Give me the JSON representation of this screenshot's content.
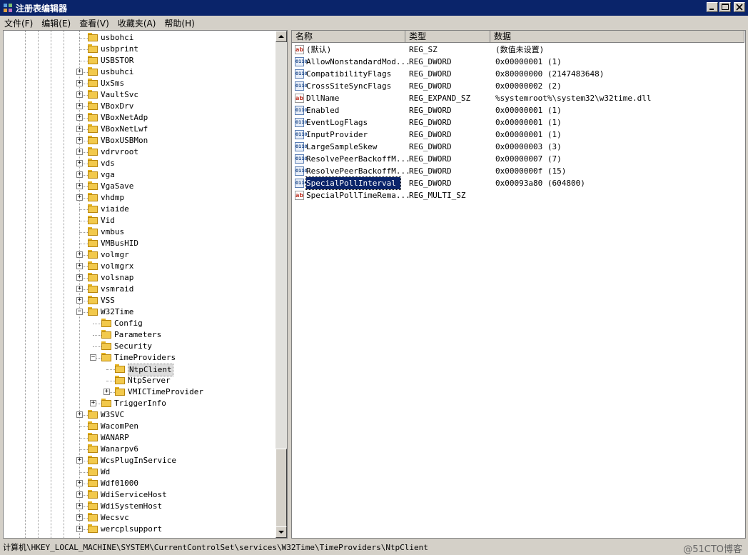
{
  "window": {
    "title": "注册表编辑器",
    "minimize_glyph": "_",
    "maximize_glyph": "□",
    "close_glyph": "×"
  },
  "menu": [
    "文件(F)",
    "编辑(E)",
    "查看(V)",
    "收藏夹(A)",
    "帮助(H)"
  ],
  "tree": {
    "items": [
      {
        "label": "usbohci",
        "level": 0,
        "expander": ""
      },
      {
        "label": "usbprint",
        "level": 0,
        "expander": ""
      },
      {
        "label": "USBSTOR",
        "level": 0,
        "expander": ""
      },
      {
        "label": "usbuhci",
        "level": 0,
        "expander": "+"
      },
      {
        "label": "UxSms",
        "level": 0,
        "expander": "+"
      },
      {
        "label": "VaultSvc",
        "level": 0,
        "expander": "+"
      },
      {
        "label": "VBoxDrv",
        "level": 0,
        "expander": "+"
      },
      {
        "label": "VBoxNetAdp",
        "level": 0,
        "expander": "+"
      },
      {
        "label": "VBoxNetLwf",
        "level": 0,
        "expander": "+"
      },
      {
        "label": "VBoxUSBMon",
        "level": 0,
        "expander": "+"
      },
      {
        "label": "vdrvroot",
        "level": 0,
        "expander": "+"
      },
      {
        "label": "vds",
        "level": 0,
        "expander": "+"
      },
      {
        "label": "vga",
        "level": 0,
        "expander": "+"
      },
      {
        "label": "VgaSave",
        "level": 0,
        "expander": "+"
      },
      {
        "label": "vhdmp",
        "level": 0,
        "expander": "+"
      },
      {
        "label": "viaide",
        "level": 0,
        "expander": ""
      },
      {
        "label": "Vid",
        "level": 0,
        "expander": ""
      },
      {
        "label": "vmbus",
        "level": 0,
        "expander": ""
      },
      {
        "label": "VMBusHID",
        "level": 0,
        "expander": ""
      },
      {
        "label": "volmgr",
        "level": 0,
        "expander": "+"
      },
      {
        "label": "volmgrx",
        "level": 0,
        "expander": "+"
      },
      {
        "label": "volsnap",
        "level": 0,
        "expander": "+"
      },
      {
        "label": "vsmraid",
        "level": 0,
        "expander": "+"
      },
      {
        "label": "VSS",
        "level": 0,
        "expander": "+"
      },
      {
        "label": "W32Time",
        "level": 0,
        "expander": "−"
      },
      {
        "label": "Config",
        "level": 1,
        "expander": ""
      },
      {
        "label": "Parameters",
        "level": 1,
        "expander": ""
      },
      {
        "label": "Security",
        "level": 1,
        "expander": ""
      },
      {
        "label": "TimeProviders",
        "level": 1,
        "expander": "−"
      },
      {
        "label": "NtpClient",
        "level": 2,
        "expander": "",
        "selected": true
      },
      {
        "label": "NtpServer",
        "level": 2,
        "expander": ""
      },
      {
        "label": "VMICTimeProvider",
        "level": 2,
        "expander": "+"
      },
      {
        "label": "TriggerInfo",
        "level": 1,
        "expander": "+"
      },
      {
        "label": "W3SVC",
        "level": 0,
        "expander": "+"
      },
      {
        "label": "WacomPen",
        "level": 0,
        "expander": ""
      },
      {
        "label": "WANARP",
        "level": 0,
        "expander": ""
      },
      {
        "label": "Wanarpv6",
        "level": 0,
        "expander": ""
      },
      {
        "label": "WcsPlugInService",
        "level": 0,
        "expander": "+"
      },
      {
        "label": "Wd",
        "level": 0,
        "expander": ""
      },
      {
        "label": "Wdf01000",
        "level": 0,
        "expander": "+"
      },
      {
        "label": "WdiServiceHost",
        "level": 0,
        "expander": "+"
      },
      {
        "label": "WdiSystemHost",
        "level": 0,
        "expander": "+"
      },
      {
        "label": "Wecsvc",
        "level": 0,
        "expander": "+"
      },
      {
        "label": "wercplsupport",
        "level": 0,
        "expander": "+"
      }
    ]
  },
  "list": {
    "headers": {
      "name": "名称",
      "type": "类型",
      "data": "数据"
    },
    "rows": [
      {
        "icon": "string-value-icon",
        "name": "(默认)",
        "type": "REG_SZ",
        "data": "(数值未设置)"
      },
      {
        "icon": "binary-value-icon",
        "name": "AllowNonstandardMod...",
        "type": "REG_DWORD",
        "data": "0x00000001 (1)"
      },
      {
        "icon": "binary-value-icon",
        "name": "CompatibilityFlags",
        "type": "REG_DWORD",
        "data": "0x80000000 (2147483648)"
      },
      {
        "icon": "binary-value-icon",
        "name": "CrossSiteSyncFlags",
        "type": "REG_DWORD",
        "data": "0x00000002 (2)"
      },
      {
        "icon": "string-value-icon",
        "name": "DllName",
        "type": "REG_EXPAND_SZ",
        "data": "%systemroot%\\system32\\w32time.dll"
      },
      {
        "icon": "binary-value-icon",
        "name": "Enabled",
        "type": "REG_DWORD",
        "data": "0x00000001 (1)"
      },
      {
        "icon": "binary-value-icon",
        "name": "EventLogFlags",
        "type": "REG_DWORD",
        "data": "0x00000001 (1)"
      },
      {
        "icon": "binary-value-icon",
        "name": "InputProvider",
        "type": "REG_DWORD",
        "data": "0x00000001 (1)"
      },
      {
        "icon": "binary-value-icon",
        "name": "LargeSampleSkew",
        "type": "REG_DWORD",
        "data": "0x00000003 (3)"
      },
      {
        "icon": "binary-value-icon",
        "name": "ResolvePeerBackoffM...",
        "type": "REG_DWORD",
        "data": "0x00000007 (7)"
      },
      {
        "icon": "binary-value-icon",
        "name": "ResolvePeerBackoffM...",
        "type": "REG_DWORD",
        "data": "0x0000000f (15)"
      },
      {
        "icon": "binary-value-icon",
        "name": "SpecialPollInterval",
        "type": "REG_DWORD",
        "data": "0x00093a80 (604800)",
        "selected": true
      },
      {
        "icon": "string-value-icon",
        "name": "SpecialPollTimeRema...",
        "type": "REG_MULTI_SZ",
        "data": ""
      }
    ]
  },
  "status": {
    "path": "计算机\\HKEY_LOCAL_MACHINE\\SYSTEM\\CurrentControlSet\\services\\W32Time\\TimeProviders\\NtpClient",
    "watermark": "@51CTO博客"
  },
  "colors": {
    "titlebar": "#0a246a",
    "chrome": "#d4d0c8",
    "selection": "#0a246a",
    "folder": "#f2c94c"
  }
}
